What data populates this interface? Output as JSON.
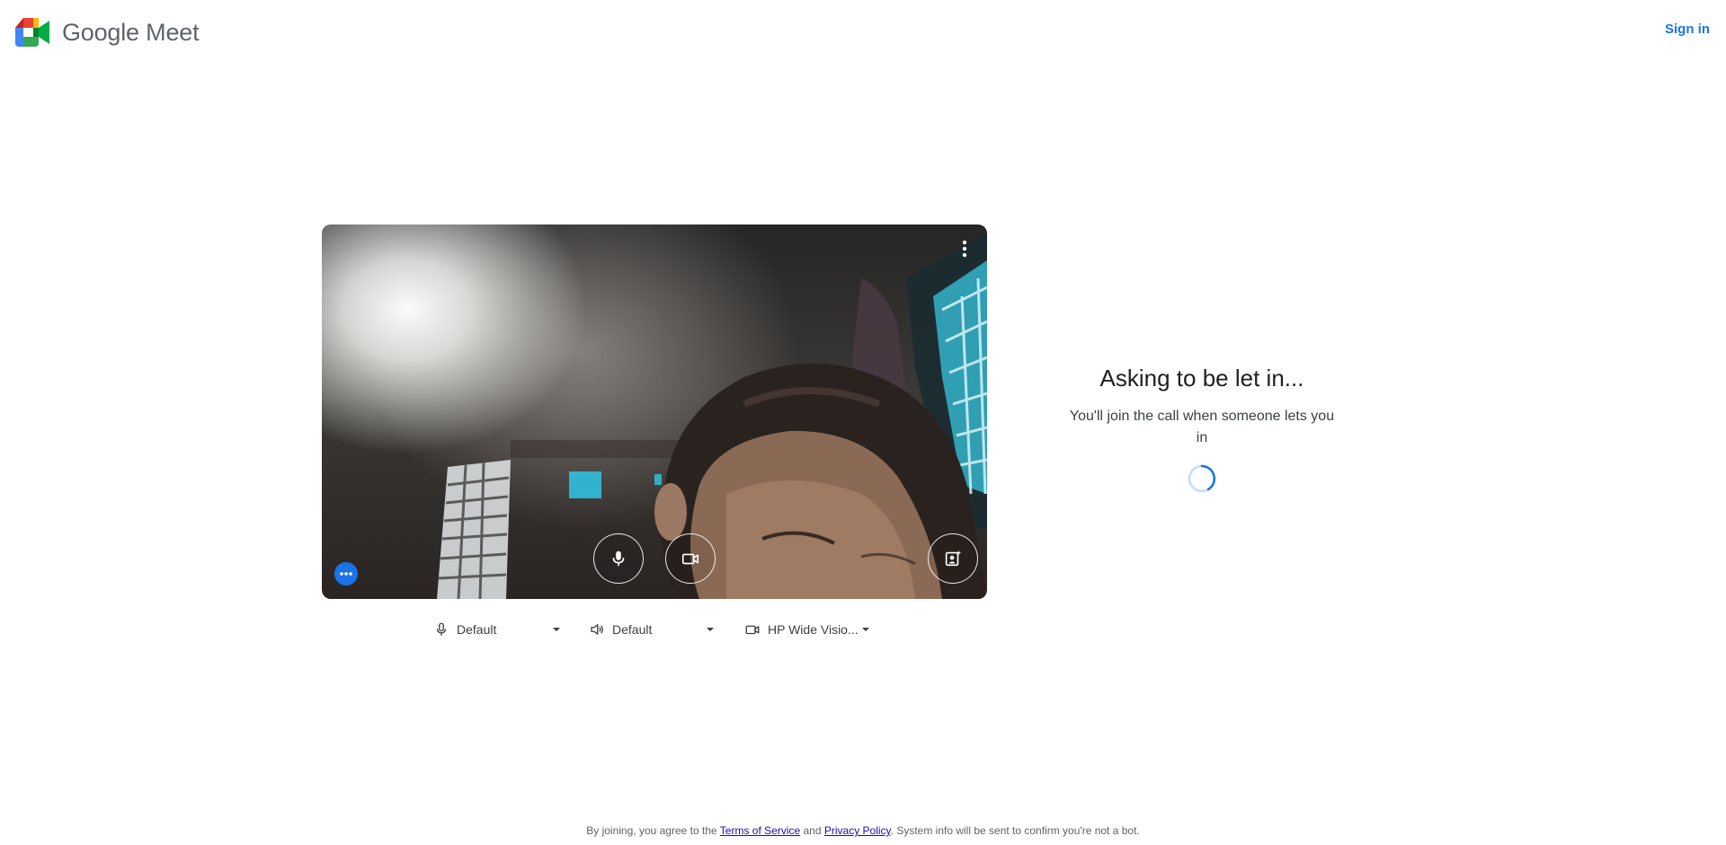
{
  "header": {
    "app_name": "Google Meet",
    "signin_label": "Sign in"
  },
  "preview": {
    "icons": {
      "more_options": "more-vert-icon",
      "microphone": "mic-icon",
      "camera": "videocam-icon",
      "effects": "visual-effects-icon",
      "overflow": "more-horiz-icon"
    }
  },
  "devices": {
    "microphone": {
      "icon": "mic-icon",
      "selected": "Default"
    },
    "speaker": {
      "icon": "volume-icon",
      "selected": "Default"
    },
    "camera": {
      "icon": "videocam-icon",
      "selected": "HP Wide Visio..."
    }
  },
  "status": {
    "title": "Asking to be let in...",
    "subtitle": "You'll join the call when someone lets you in"
  },
  "footer": {
    "prefix": "By joining, you agree to the ",
    "terms_label": "Terms of Service",
    "and_text": " and ",
    "privacy_label": "Privacy Policy",
    "suffix": ". System info will be sent to confirm you're not a bot."
  },
  "colors": {
    "accent": "#1a73e8",
    "text_primary": "#202124",
    "text_secondary": "#5f6368",
    "link": "#1a0dab"
  }
}
